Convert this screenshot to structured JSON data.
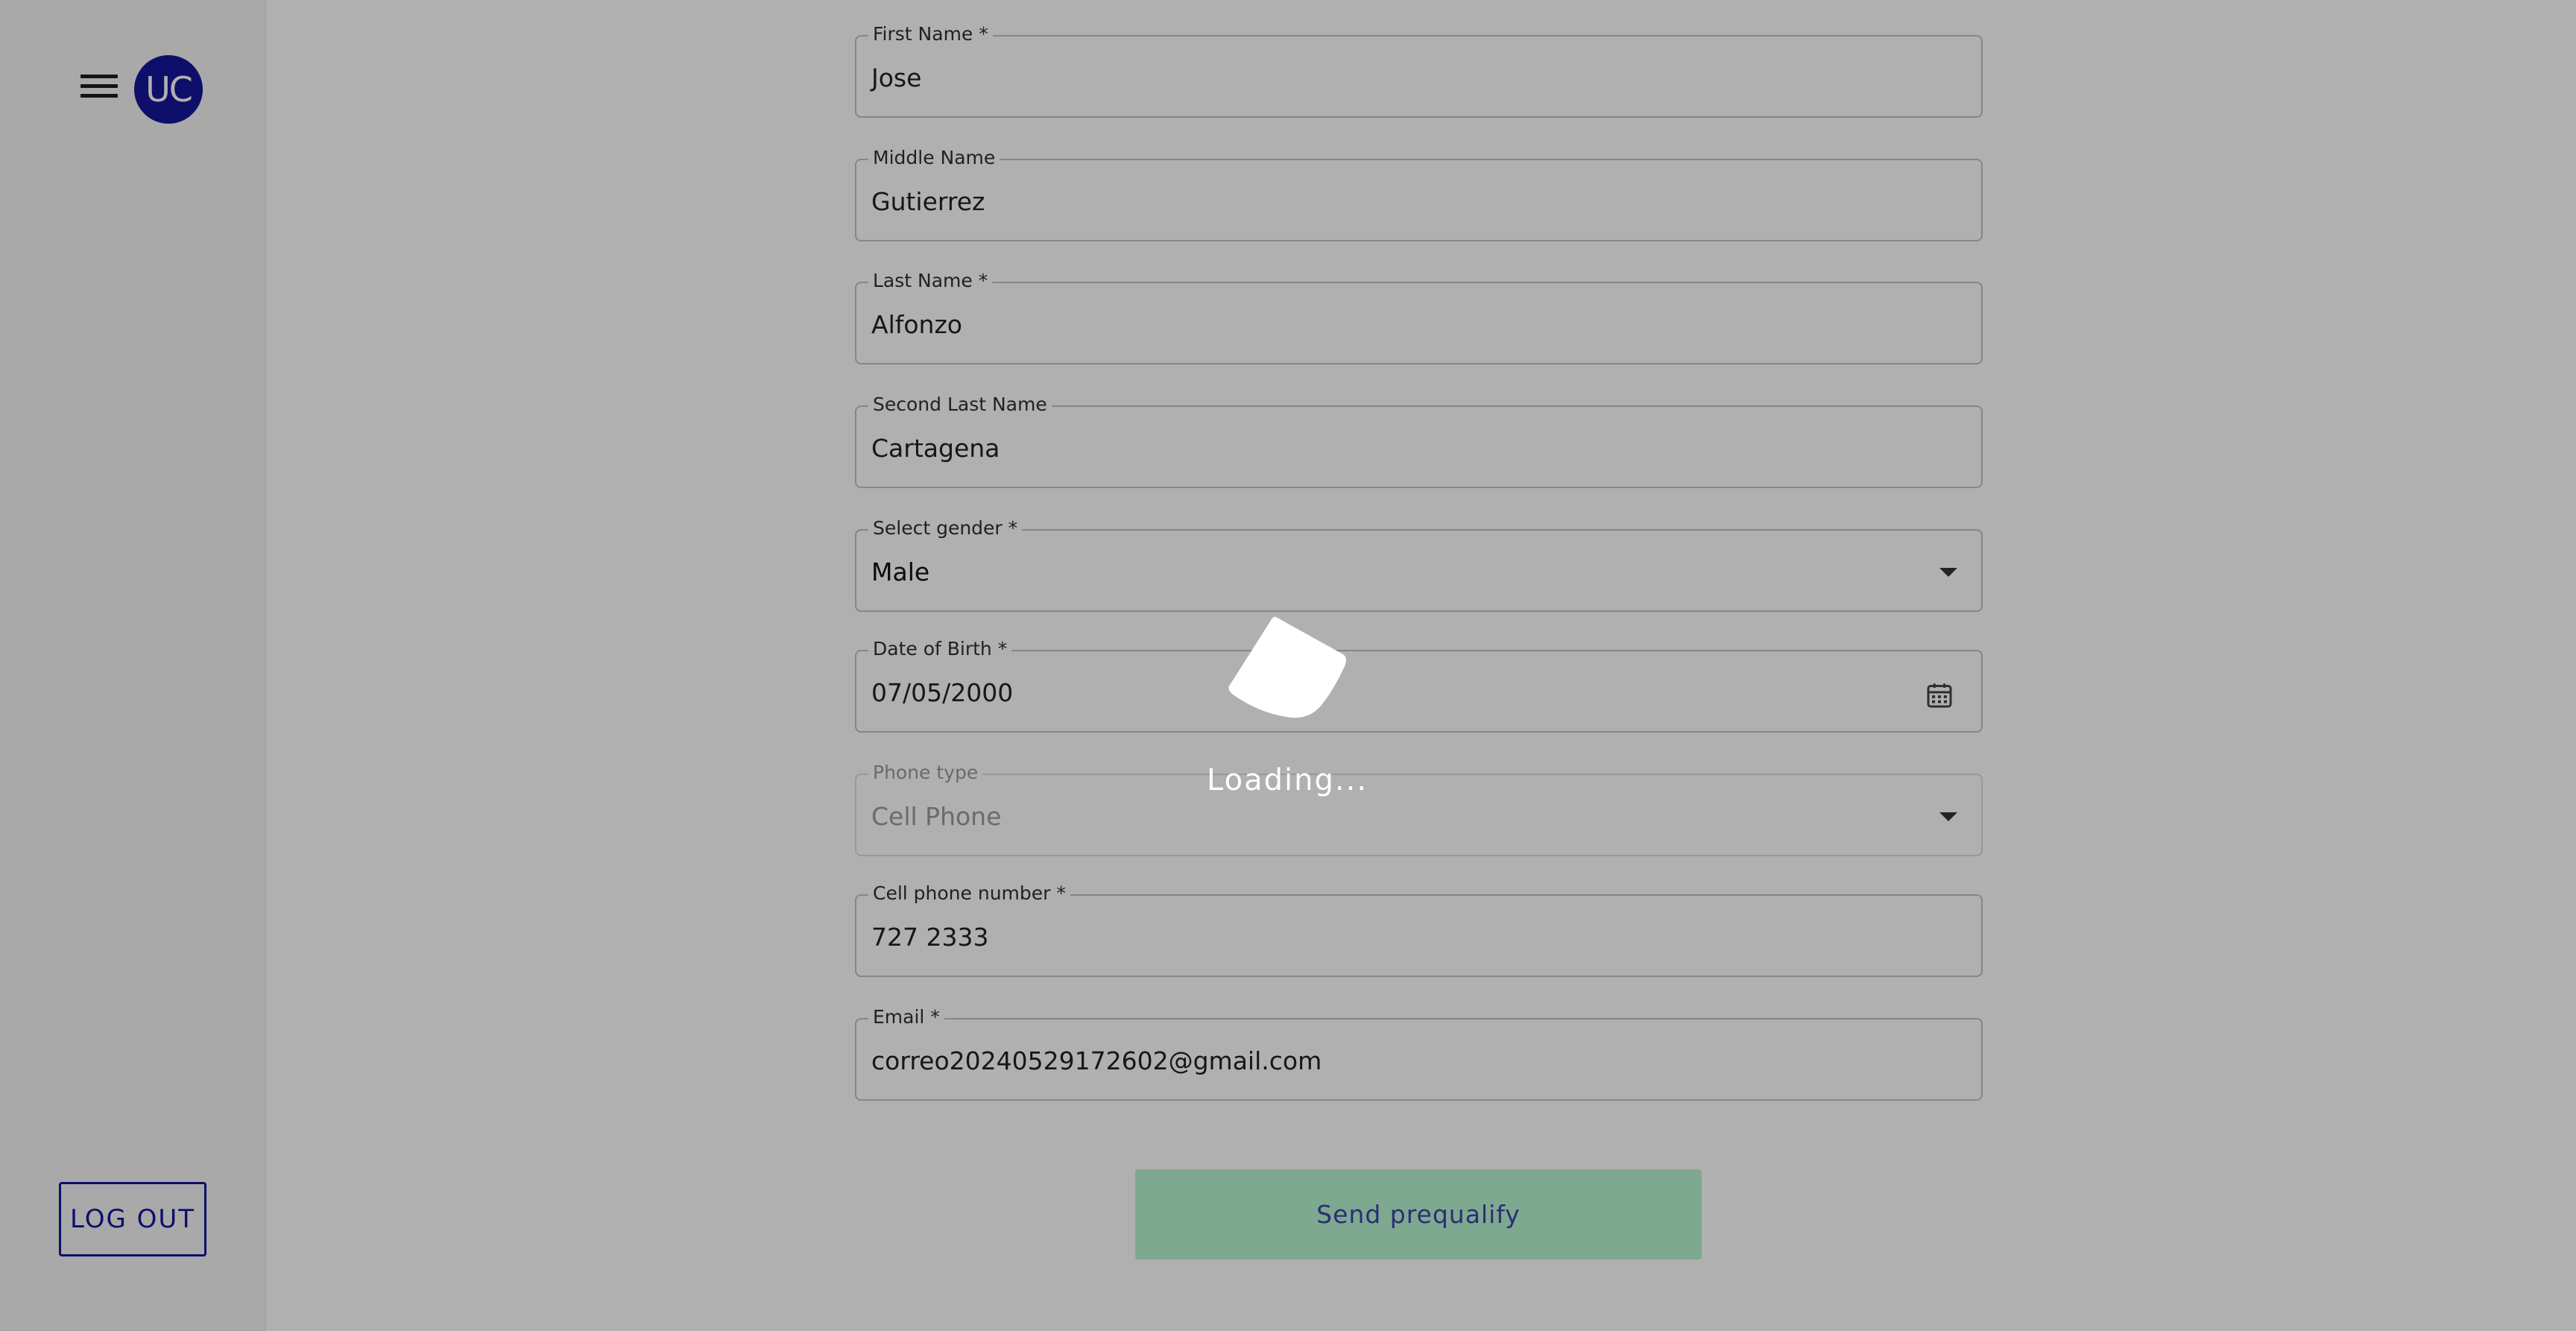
{
  "sidebar": {
    "avatar_initials": "UC",
    "logout_label": "LOG OUT"
  },
  "form": {
    "first_name": {
      "label": "First Name *",
      "value": "Jose"
    },
    "middle_name": {
      "label": "Middle Name",
      "value": "Gutierrez"
    },
    "last_name": {
      "label": "Last Name *",
      "value": "Alfonzo"
    },
    "second_last_name": {
      "label": "Second Last Name",
      "value": "Cartagena"
    },
    "gender": {
      "label": "Select gender *",
      "value": "Male"
    },
    "dob": {
      "label": "Date of Birth *",
      "value": "07/05/2000"
    },
    "phone_type": {
      "label": "Phone type",
      "value": "Cell Phone"
    },
    "cell_phone": {
      "label": "Cell phone number *",
      "value": "727 2333"
    },
    "email": {
      "label": "Email *",
      "value": "correo20240529172602@gmail.com"
    },
    "submit_label": "Send prequalify"
  },
  "loading": {
    "text": "Loading..."
  },
  "colors": {
    "brand": "#15159c",
    "submit_bg": "#b9f3d3",
    "overlay": "rgba(0,0,0,0.31)"
  }
}
